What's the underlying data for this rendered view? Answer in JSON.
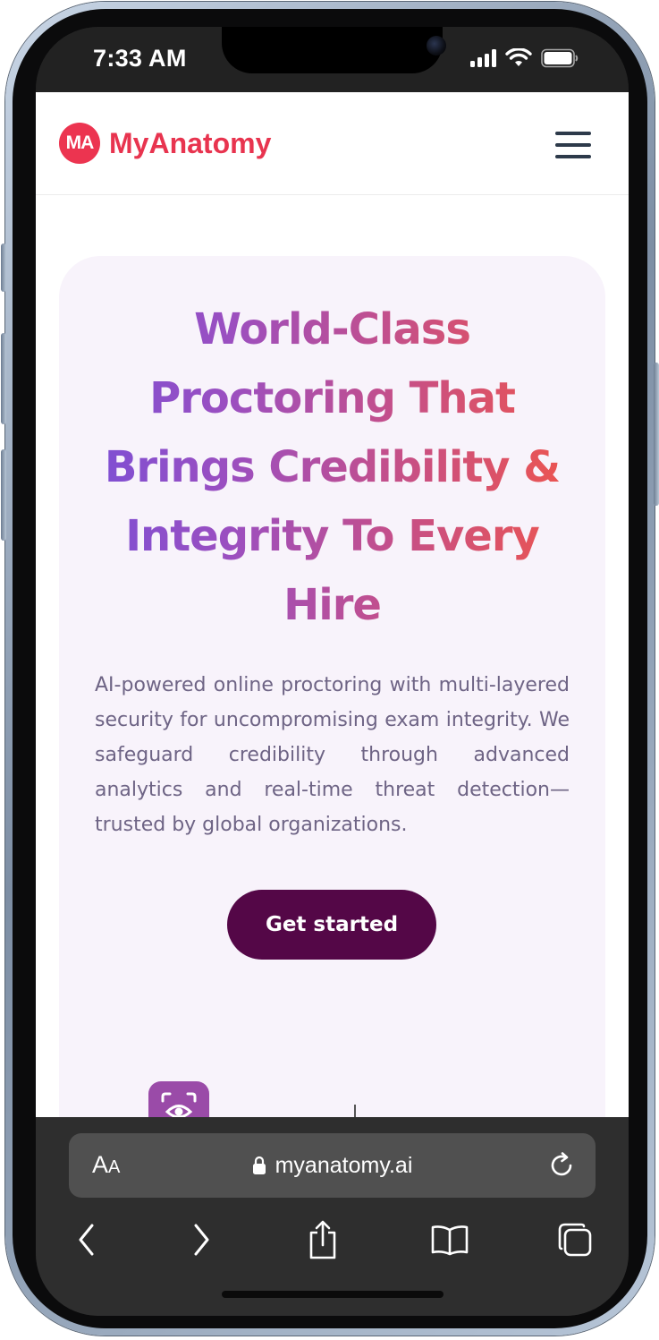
{
  "status_bar": {
    "time": "7:33 AM",
    "icons": [
      "cellular-signal-icon",
      "wifi-icon",
      "battery-icon"
    ]
  },
  "header": {
    "logo_mark": "MA",
    "brand_name": "MyAnatomy",
    "menu_icon": "hamburger-menu-icon"
  },
  "hero": {
    "title": "World-Class Proctoring That Brings Credibility & Integrity To Every Hire",
    "description": "AI-powered online proctoring with multi-layered security for uncompromising exam integrity. We safeguard credibility through advanced analytics and real-time threat detection—trusted by global organizations.",
    "cta_label": "Get started",
    "feature_icon": "face-scan-icon"
  },
  "browser": {
    "text_size_label_big": "A",
    "text_size_label_small": "A",
    "url": "myanatomy.ai",
    "lock_icon": "lock-icon",
    "reload_icon": "reload-icon",
    "nav": [
      "back-icon",
      "forward-icon",
      "share-icon",
      "bookmarks-icon",
      "tabs-icon"
    ]
  },
  "colors": {
    "brand": "#e8344f",
    "cta_bg": "#540747",
    "hero_bg": "#f8f3fb",
    "title_gradient_start": "#7b4fd6",
    "title_gradient_end": "#f0554a"
  }
}
